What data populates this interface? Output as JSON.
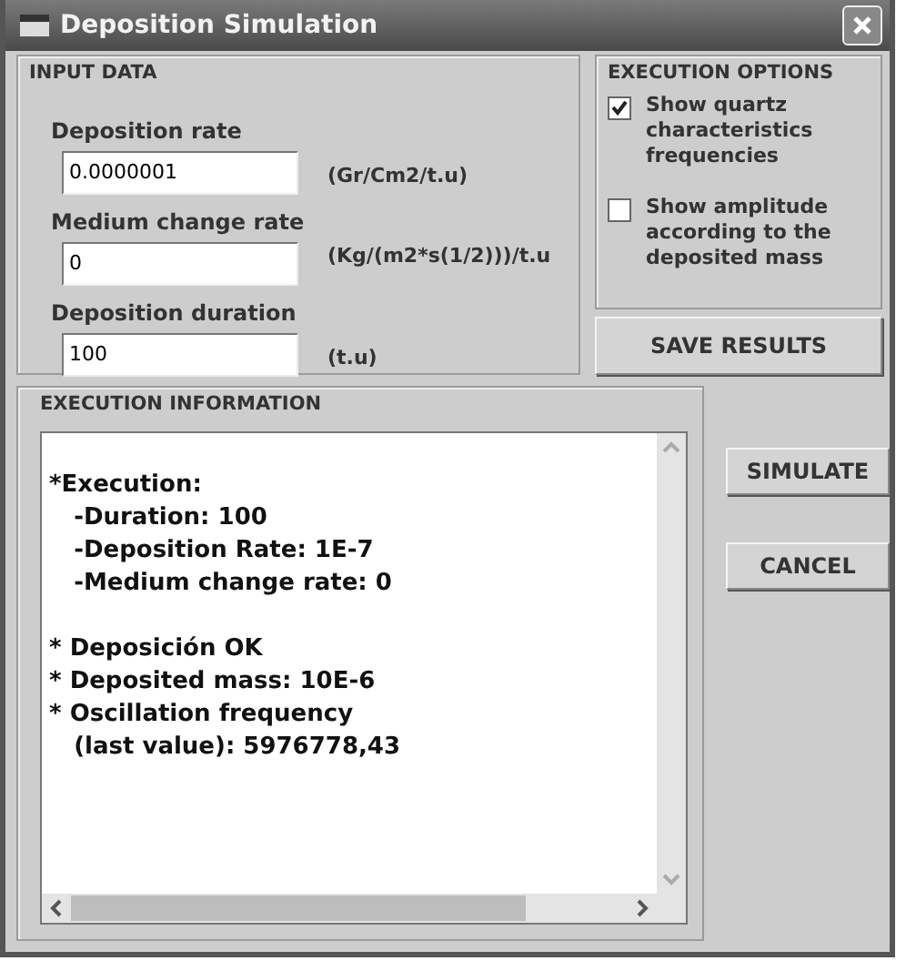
{
  "window": {
    "title": "Deposition Simulation"
  },
  "input_data": {
    "title": "INPUT DATA",
    "fields": [
      {
        "label": "Deposition rate",
        "value": "0.0000001",
        "unit": "(Gr/Cm2/t.u)"
      },
      {
        "label": "Medium change rate",
        "value": "0",
        "unit": "(Kg/(m2*s(1/2)))/t.u"
      },
      {
        "label": "Deposition duration",
        "value": "100",
        "unit": "(t.u)"
      }
    ]
  },
  "execution_options": {
    "title": "EXECUTION OPTIONS",
    "options": [
      {
        "label": "Show quartz characteristics frequencies",
        "checked": true
      },
      {
        "label": "Show amplitude according to the deposited mass",
        "checked": false
      }
    ]
  },
  "save_button": "SAVE RESULTS",
  "execution_information": {
    "title": "EXECUTION INFORMATION",
    "log": "\n*Execution:\n   -Duration: 100\n   -Deposition Rate: 1E-7\n   -Medium change rate: 0\n\n* Deposición OK\n* Deposited mass: 10E-6\n* Oscillation frequency\n   (last value): 5976778,43"
  },
  "buttons": [
    "SIMULATE",
    "CANCEL"
  ]
}
